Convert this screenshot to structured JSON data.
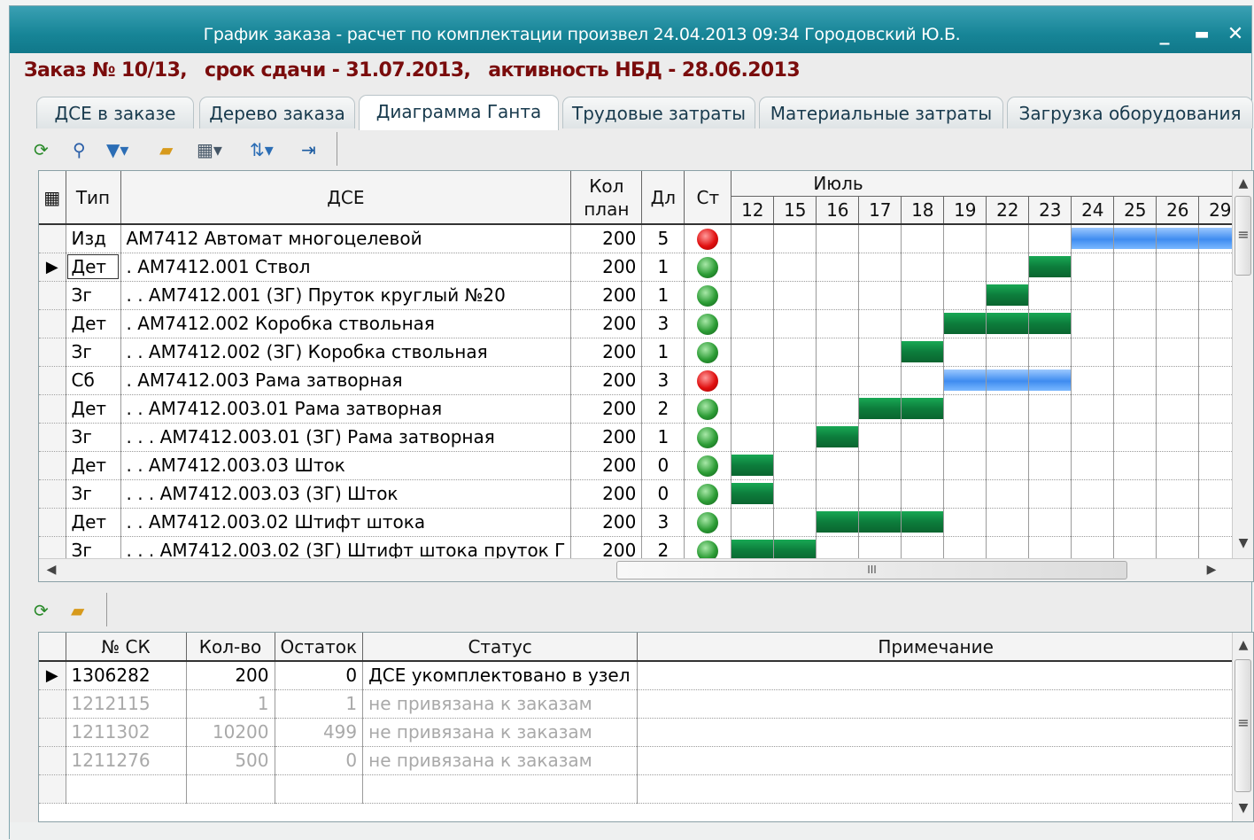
{
  "window": {
    "title": "График заказа - расчет по комплектации произвел 24.04.2013 09:34  Городовский Ю.Б.",
    "min": "_",
    "max": "▬",
    "close": "✕"
  },
  "order": {
    "number": "Заказ № 10/13,",
    "deadline": "срок сдачи - 31.07.2013,",
    "activity": "активность НБД - 28.06.2013"
  },
  "tabs": [
    "ДСЕ в заказе",
    "Дерево заказа",
    "Диаграмма Ганта",
    "Трудовые затраты",
    "Материальные затраты",
    "Загрузка оборудования"
  ],
  "active_tab": "Диаграмма Ганта",
  "toolbar_icons": [
    "refresh-icon",
    "search-icon",
    "filter-icon",
    "open-folder-icon",
    "settings-icon",
    "sort-icon",
    "exit-icon"
  ],
  "gantt": {
    "headers": {
      "type": "Тип",
      "dse": "ДСЕ",
      "qty": "Кол план",
      "dur": "Дл",
      "status": "Ст",
      "month": "Июль"
    },
    "days": [
      "12",
      "15",
      "16",
      "17",
      "18",
      "19",
      "22",
      "23",
      "24",
      "25",
      "26",
      "29"
    ],
    "rows": [
      {
        "type": "Изд",
        "dse": "АМ7412 Автомат многоцелевой",
        "qty": "200",
        "dur": "5",
        "status": "red",
        "bar": {
          "start": 8,
          "len": 4,
          "color": "blue"
        }
      },
      {
        "type": "Дет",
        "dse": ". АМ7412.001 Ствол",
        "qty": "200",
        "dur": "1",
        "status": "green",
        "bar": {
          "start": 7,
          "len": 1,
          "color": "green"
        },
        "selected": true
      },
      {
        "type": "Зг",
        "dse": ". . АМ7412.001 (ЗГ) Пруток круглый №20",
        "qty": "200",
        "dur": "1",
        "status": "green",
        "bar": {
          "start": 6,
          "len": 1,
          "color": "green"
        }
      },
      {
        "type": "Дет",
        "dse": ". АМ7412.002 Коробка ствольная",
        "qty": "200",
        "dur": "3",
        "status": "green",
        "bar": {
          "start": 5,
          "len": 3,
          "color": "green"
        }
      },
      {
        "type": "Зг",
        "dse": ". . АМ7412.002 (ЗГ) Коробка ствольная",
        "qty": "200",
        "dur": "1",
        "status": "green",
        "bar": {
          "start": 4,
          "len": 1,
          "color": "green"
        }
      },
      {
        "type": "Сб",
        "dse": ". АМ7412.003 Рама затворная",
        "qty": "200",
        "dur": "3",
        "status": "red",
        "bar": {
          "start": 5,
          "len": 3,
          "color": "blue"
        }
      },
      {
        "type": "Дет",
        "dse": ". . АМ7412.003.01 Рама затворная",
        "qty": "200",
        "dur": "2",
        "status": "green",
        "bar": {
          "start": 3,
          "len": 2,
          "color": "green"
        }
      },
      {
        "type": "Зг",
        "dse": ". . . АМ7412.003.01 (ЗГ) Рама затворная",
        "qty": "200",
        "dur": "1",
        "status": "green",
        "bar": {
          "start": 2,
          "len": 1,
          "color": "green"
        }
      },
      {
        "type": "Дет",
        "dse": ". . АМ7412.003.03 Шток",
        "qty": "200",
        "dur": "0",
        "status": "green",
        "bar": {
          "start": 0,
          "len": 1,
          "color": "green"
        }
      },
      {
        "type": "Зг",
        "dse": ". . . АМ7412.003.03 (ЗГ) Шток",
        "qty": "200",
        "dur": "0",
        "status": "green",
        "bar": {
          "start": 0,
          "len": 1,
          "color": "green"
        }
      },
      {
        "type": "Дет",
        "dse": ". . АМ7412.003.02 Штифт штока",
        "qty": "200",
        "dur": "3",
        "status": "green",
        "bar": {
          "start": 2,
          "len": 3,
          "color": "green"
        }
      },
      {
        "type": "Зг",
        "dse": ". . . АМ7412.003.02 (ЗГ) Штифт штока пруток Г",
        "qty": "200",
        "dur": "2",
        "status": "green",
        "bar": {
          "start": 0,
          "len": 2,
          "color": "green"
        }
      }
    ]
  },
  "lower_toolbar_icons": [
    "refresh-icon",
    "open-folder-icon"
  ],
  "sk": {
    "headers": {
      "num": "№ СК",
      "qty": "Кол-во",
      "rest": "Остаток",
      "status": "Статус",
      "note": "Примечание"
    },
    "rows": [
      {
        "num": "1306282",
        "qty": "200",
        "rest": "0",
        "status": "ДСЕ укомплектовано в узел",
        "note": "",
        "active": true
      },
      {
        "num": "1212115",
        "qty": "1",
        "rest": "1",
        "status": "не привязана к заказам",
        "note": "",
        "active": false
      },
      {
        "num": "1211302",
        "qty": "10200",
        "rest": "499",
        "status": "не привязана к заказам",
        "note": "",
        "active": false
      },
      {
        "num": "1211276",
        "qty": "500",
        "rest": "0",
        "status": "не привязана к заказам",
        "note": "",
        "active": false
      }
    ]
  },
  "scroll_marks": {
    "h": "III",
    "v": "≡"
  }
}
